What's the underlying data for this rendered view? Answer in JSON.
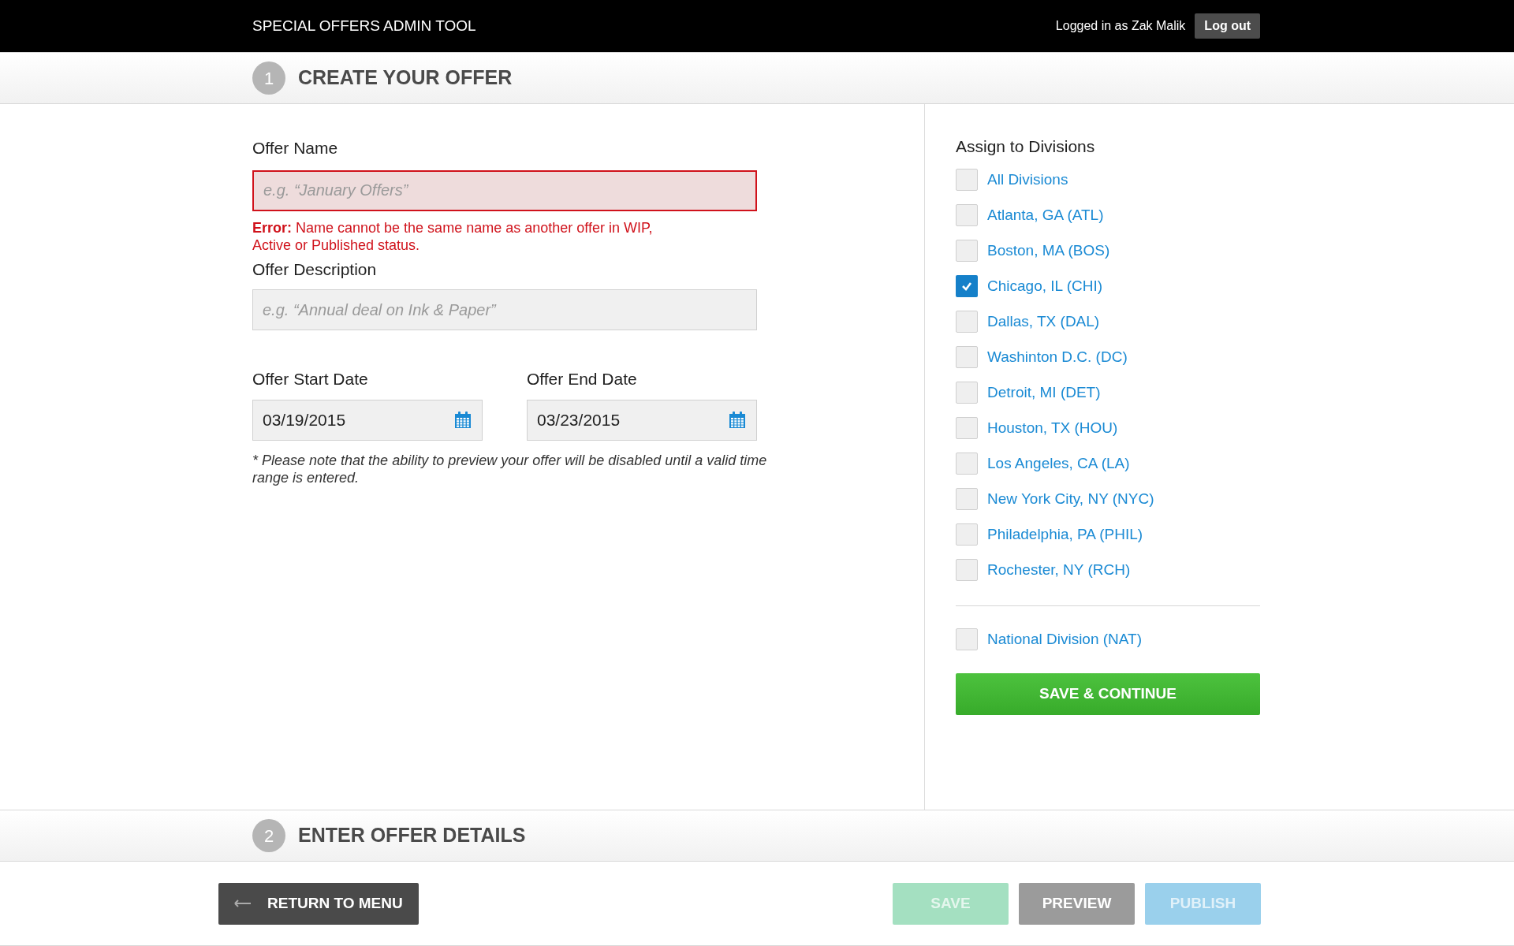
{
  "header": {
    "title": "SPECIAL OFFERS ADMIN TOOL",
    "user_text": "Logged in as Zak Malik",
    "logout": "Log out"
  },
  "step1": {
    "number": "1",
    "title": "CREATE YOUR OFFER"
  },
  "form": {
    "name": {
      "label": "Offer Name",
      "placeholder": "e.g. “January Offers”",
      "error": true
    },
    "error_text": "**Error:** Name cannot be the same name as another offer in WIP,\nActive or Published status.",
    "description": {
      "label": "Offer Description",
      "placeholder": "e.g. “Annual deal on Ink & Paper”"
    },
    "start": {
      "label": "Offer Start Date",
      "value": "03/19/2015"
    },
    "end": {
      "label": "Offer End Date",
      "value": "03/23/2015"
    },
    "note": "* Please note that the ability to preview your offer will be disabled until a valid time range is entered."
  },
  "divisions": {
    "title": "Assign to Divisions",
    "items": [
      {
        "label": "All Divisions",
        "checked": false
      },
      {
        "label": "Atlanta, GA (ATL)",
        "checked": false
      },
      {
        "label": "Boston, MA (BOS)",
        "checked": false
      },
      {
        "label": "Chicago, IL (CHI)",
        "checked": true
      },
      {
        "label": "Dallas, TX (DAL)",
        "checked": false
      },
      {
        "label": "Washinton D.C. (DC)",
        "checked": false
      },
      {
        "label": "Detroit, MI (DET)",
        "checked": false
      },
      {
        "label": "Houston, TX (HOU)",
        "checked": false
      },
      {
        "label": "Los Angeles, CA (LA)",
        "checked": false
      },
      {
        "label": "New York City, NY (NYC)",
        "checked": false
      },
      {
        "label": "Philadelphia, PA (PHIL)",
        "checked": false
      },
      {
        "label": "Rochester, NY (RCH)",
        "checked": false
      }
    ],
    "national": [
      {
        "label": "National Division (NAT)",
        "checked": false
      }
    ],
    "submit": "SAVE & CONTINUE"
  },
  "step2": {
    "number": "2",
    "title": "ENTER OFFER DETAILS"
  },
  "footer": {
    "return": "RETURN TO MENU",
    "buttons": [
      {
        "label": "SAVE",
        "kind": "save",
        "disabled": true
      },
      {
        "label": "PREVIEW",
        "kind": "preview",
        "disabled": false
      },
      {
        "label": "PUBLISH",
        "kind": "publish",
        "disabled": true
      }
    ]
  }
}
